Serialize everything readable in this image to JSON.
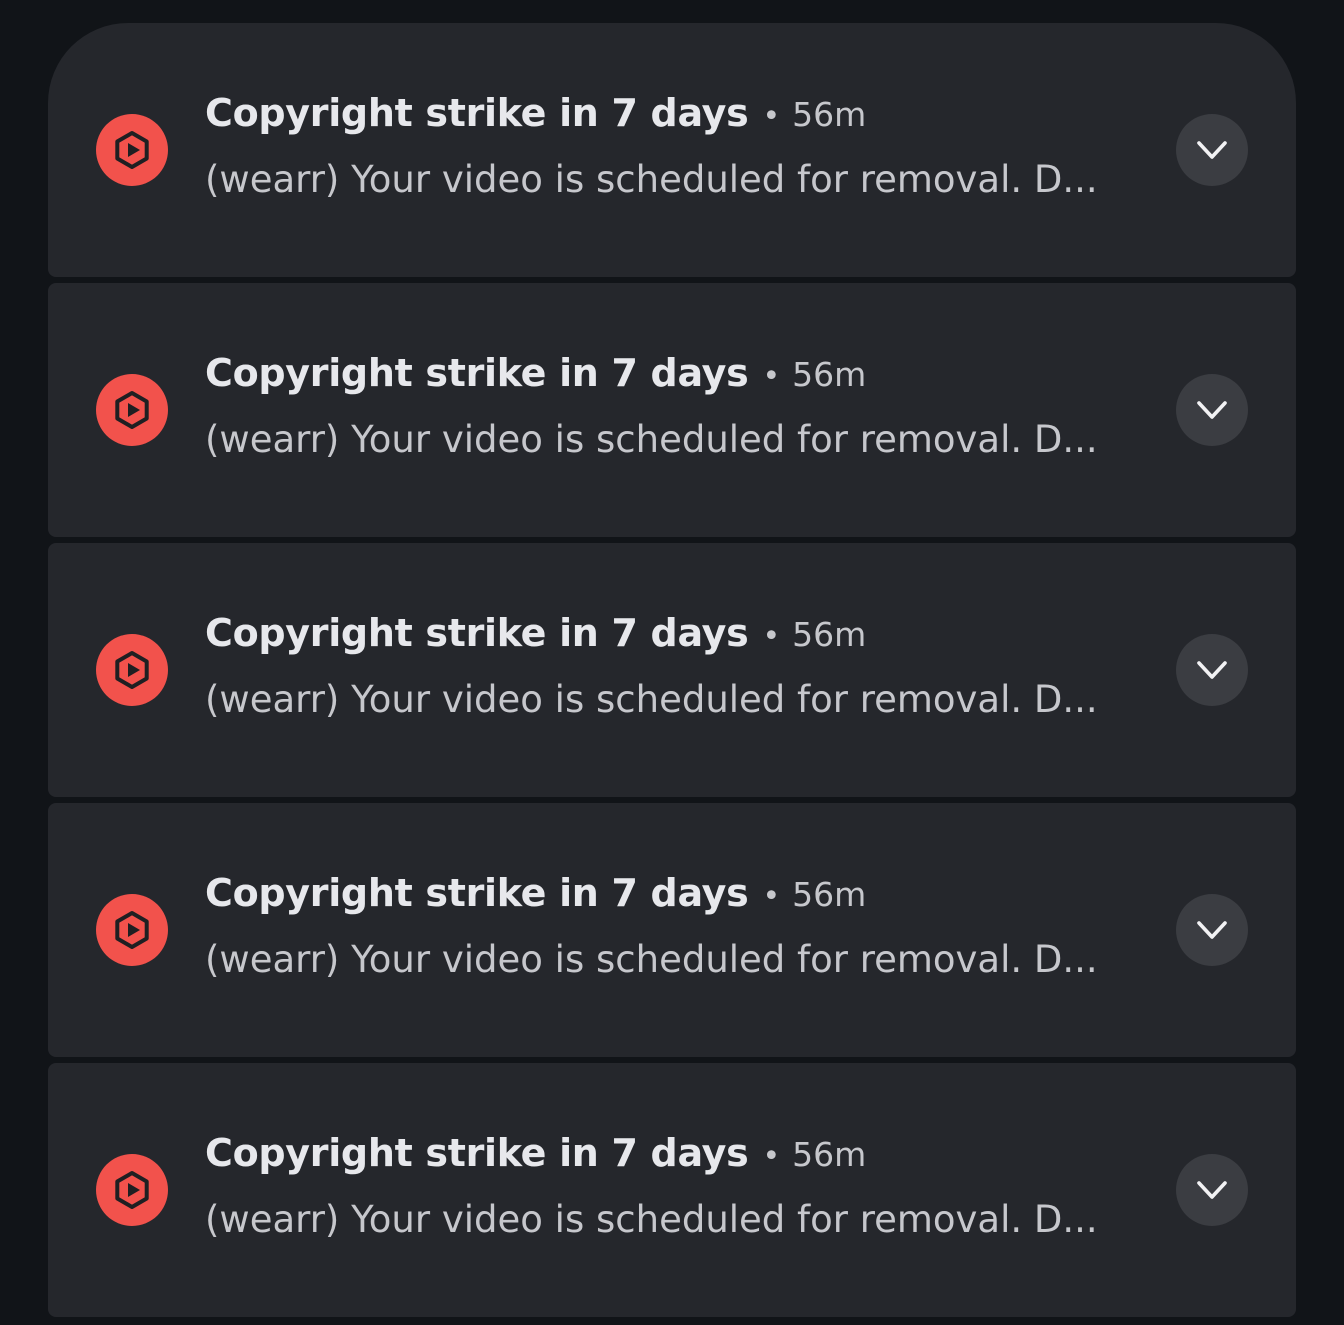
{
  "colors": {
    "background": "#111418",
    "card": "#25272c",
    "app_icon": "#f2524c",
    "title_text": "#e7e8ec",
    "secondary_text": "#c6c7cc",
    "expand_button": "#3b3d42"
  },
  "notifications": [
    {
      "app_icon": "youtube-studio-icon",
      "title": "Copyright strike in 7 days",
      "separator": "•",
      "time": "56m",
      "body": "(wearr) Your video is scheduled for removal. D...",
      "expand_icon": "chevron-down-icon"
    },
    {
      "app_icon": "youtube-studio-icon",
      "title": "Copyright strike in 7 days",
      "separator": "•",
      "time": "56m",
      "body": "(wearr) Your video is scheduled for removal. D...",
      "expand_icon": "chevron-down-icon"
    },
    {
      "app_icon": "youtube-studio-icon",
      "title": "Copyright strike in 7 days",
      "separator": "•",
      "time": "56m",
      "body": "(wearr) Your video is scheduled for removal. D...",
      "expand_icon": "chevron-down-icon"
    },
    {
      "app_icon": "youtube-studio-icon",
      "title": "Copyright strike in 7 days",
      "separator": "•",
      "time": "56m",
      "body": "(wearr) Your video is scheduled for removal. D...",
      "expand_icon": "chevron-down-icon"
    },
    {
      "app_icon": "youtube-studio-icon",
      "title": "Copyright strike in 7 days",
      "separator": "•",
      "time": "56m",
      "body": "(wearr) Your video is scheduled for removal. D...",
      "expand_icon": "chevron-down-icon"
    }
  ]
}
